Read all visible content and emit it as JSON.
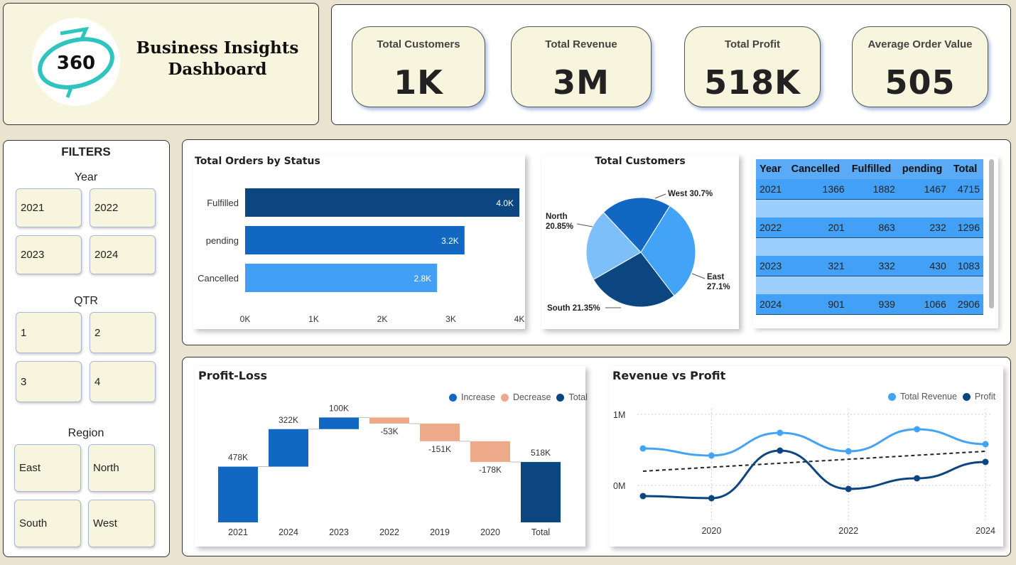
{
  "header": {
    "logo_text": "360",
    "title_line1": "Business Insights",
    "title_line2": "Dashboard"
  },
  "kpis": [
    {
      "label": "Total Customers",
      "value": "1K"
    },
    {
      "label": "Total Revenue",
      "value": "3M"
    },
    {
      "label": "Total Profit",
      "value": "518K"
    },
    {
      "label": "Average Order Value",
      "value": "505"
    }
  ],
  "filters": {
    "title": "FILTERS",
    "year_label": "Year",
    "years": [
      "2021",
      "2022",
      "2023",
      "2024"
    ],
    "qtr_label": "QTR",
    "qtrs": [
      "1",
      "2",
      "3",
      "4"
    ],
    "region_label": "Region",
    "regions": [
      "East",
      "North",
      "South",
      "West"
    ]
  },
  "chart_data": [
    {
      "type": "bar",
      "orientation": "horizontal",
      "title": "Total Orders by Status",
      "categories": [
        "Fulfilled",
        "pending",
        "Cancelled"
      ],
      "values": [
        4000,
        3200,
        2800
      ],
      "data_labels": [
        "4.0K",
        "3.2K",
        "2.8K"
      ],
      "colors": [
        "#0b4680",
        "#1167c2",
        "#41a0f6"
      ],
      "xticks": [
        "0K",
        "1K",
        "2K",
        "3K",
        "4K"
      ],
      "xlim": [
        0,
        4000
      ]
    },
    {
      "type": "pie",
      "title": "Total Customers",
      "slices": [
        {
          "label": "West",
          "pct_label": "30.7%",
          "value": 30.7,
          "color": "#43a3f6"
        },
        {
          "label": "East",
          "pct_label": "27.1%",
          "value": 27.1,
          "color": "#0b4680"
        },
        {
          "label": "South",
          "pct_label": "21.35%",
          "value": 21.35,
          "color": "#7cbff9"
        },
        {
          "label": "North",
          "pct_label": "20.85%",
          "value": 20.85,
          "color": "#1167c2"
        }
      ]
    },
    {
      "type": "table",
      "columns": [
        "Year",
        "Cancelled",
        "Fulfilled",
        "pending",
        "Total"
      ],
      "rows": [
        [
          "2021",
          "1366",
          "1882",
          "1467",
          "4715"
        ],
        [
          "2022",
          "201",
          "863",
          "232",
          "1296"
        ],
        [
          "2023",
          "321",
          "332",
          "430",
          "1083"
        ],
        [
          "2024",
          "901",
          "939",
          "1066",
          "2906"
        ]
      ]
    },
    {
      "type": "bar",
      "subtype": "waterfall",
      "title": "Profit-Loss",
      "legend": [
        {
          "name": "Increase",
          "color": "#1167c2"
        },
        {
          "name": "Decrease",
          "color": "#eea98a"
        },
        {
          "name": "Total",
          "color": "#0b4680"
        }
      ],
      "categories": [
        "2021",
        "2024",
        "2023",
        "2022",
        "2019",
        "2020",
        "Total"
      ],
      "values": [
        478,
        322,
        100,
        -53,
        -151,
        -178,
        518
      ],
      "data_labels": [
        "478K",
        "322K",
        "100K",
        "-53K",
        "-151K",
        "-178K",
        "518K"
      ],
      "kinds": [
        "increase",
        "increase",
        "increase",
        "decrease",
        "decrease",
        "decrease",
        "total"
      ]
    },
    {
      "type": "line",
      "title": "Revenue vs Profit",
      "x": [
        2019,
        2020,
        2021,
        2022,
        2023,
        2024
      ],
      "xticks": [
        "2020",
        "2022",
        "2024"
      ],
      "yticks": [
        "1M",
        "0M"
      ],
      "ylim": [
        -0.15,
        1.0
      ],
      "series": [
        {
          "name": "Total Revenue",
          "color": "#43a3f6",
          "values": [
            0.52,
            0.42,
            0.74,
            0.48,
            0.79,
            0.58
          ]
        },
        {
          "name": "Profit",
          "color": "#0b4680",
          "values": [
            -0.15,
            -0.18,
            0.49,
            -0.05,
            0.1,
            0.33
          ]
        }
      ],
      "trendline": {
        "values": [
          0.2,
          0.48
        ],
        "style": "dashed"
      },
      "grid": true,
      "legend_position": "top-right"
    }
  ]
}
